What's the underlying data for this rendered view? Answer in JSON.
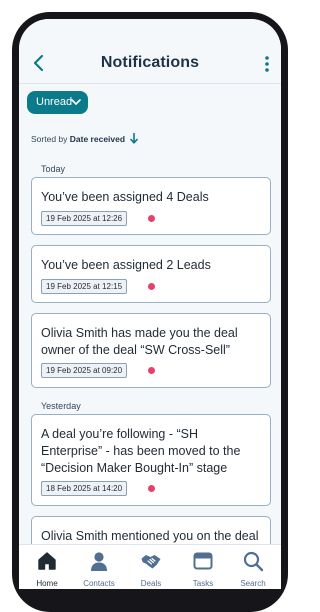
{
  "header": {
    "title": "Notifications"
  },
  "filter": {
    "label": "Unread"
  },
  "sort": {
    "prefix": "Sorted by",
    "field": "Date received"
  },
  "groups": [
    {
      "label": "Today",
      "items": [
        {
          "text": "You’ve been assigned 4 Deals",
          "date": "19 Feb 2025 at 12:26",
          "unread": true
        },
        {
          "text": "You’ve been assigned 2 Leads",
          "date": "19 Feb 2025 at 12:15",
          "unread": true
        },
        {
          "text": "Olivia Smith has made you the deal owner of the deal “SW Cross-Sell”",
          "date": "19 Feb 2025 at 09:20",
          "unread": true
        }
      ]
    },
    {
      "label": "Yesterday",
      "items": [
        {
          "text": "A deal you’re following - “SH Enterprise” - has been moved to the “Decision Maker Bought-In” stage",
          "date": "18 Feb 2025 at 14:20",
          "unread": true
        },
        {
          "text": "Olivia Smith mentioned you on the deal",
          "date": "",
          "unread": false
        }
      ]
    }
  ],
  "nav": [
    {
      "label": "Home",
      "icon": "home-icon",
      "active": true
    },
    {
      "label": "Contacts",
      "icon": "contacts-icon",
      "active": false
    },
    {
      "label": "Deals",
      "icon": "deals-icon",
      "active": false
    },
    {
      "label": "Tasks",
      "icon": "tasks-icon",
      "active": false
    },
    {
      "label": "Search",
      "icon": "search-icon",
      "active": false
    }
  ],
  "colors": {
    "accent": "#0b7a8a",
    "unread_dot": "#e6416c",
    "background": "#f5f8fa"
  }
}
